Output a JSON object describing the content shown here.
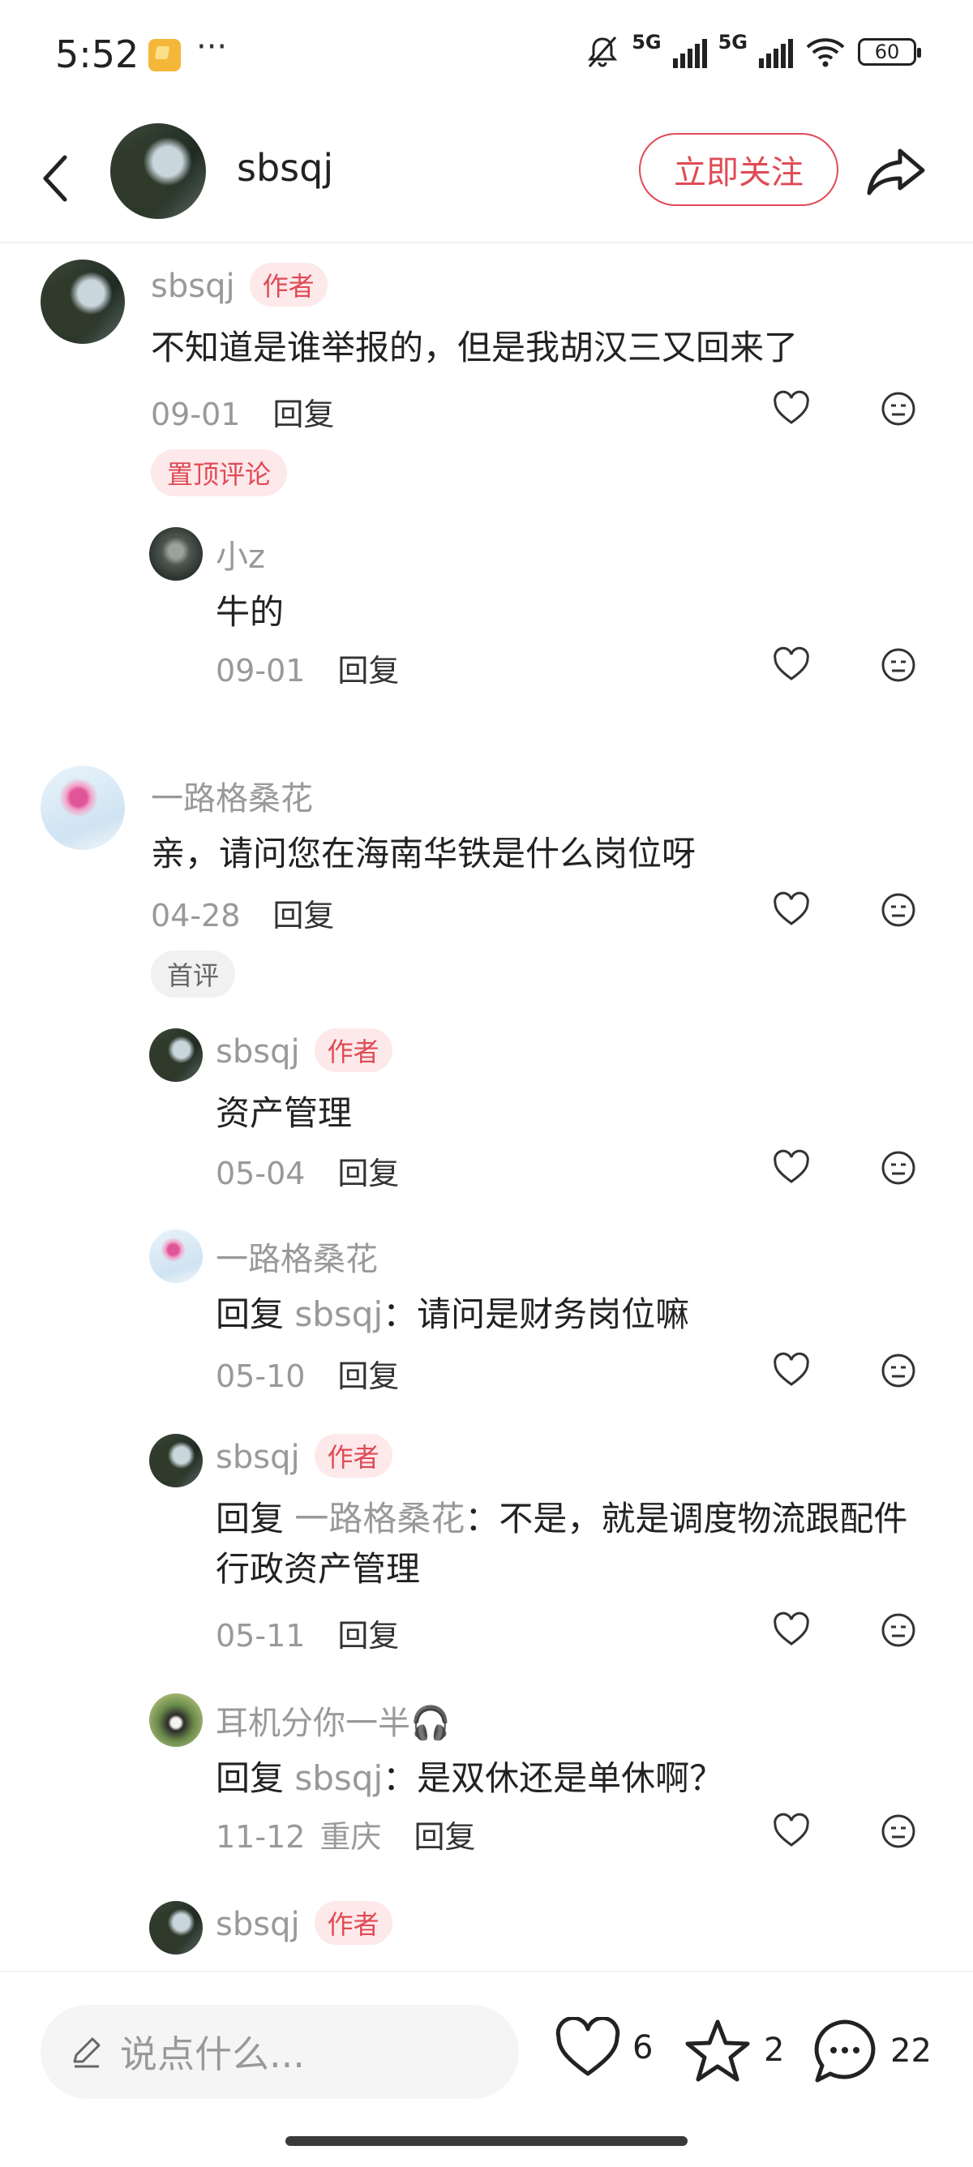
{
  "status_bar": {
    "time": "5:52",
    "more": "···",
    "network_1": "5G",
    "network_2": "5G",
    "battery": "60"
  },
  "header": {
    "username": "sbsqj",
    "follow_label": "立即关注"
  },
  "comments": [
    {
      "user": "sbsqj",
      "tag": "作者",
      "text": "不知道是谁举报的，但是我胡汉三又回来了",
      "date": "09-01",
      "reply": "回复",
      "badge": "置顶评论"
    },
    {
      "user": "小z",
      "text": "牛的",
      "date": "09-01",
      "reply": "回复"
    },
    {
      "user": "一路格桑花",
      "text": "亲，请问您在海南华铁是什么岗位呀",
      "date": "04-28",
      "reply": "回复",
      "badge": "首评"
    },
    {
      "user": "sbsqj",
      "tag": "作者",
      "text": "资产管理",
      "date": "05-04",
      "reply": "回复"
    },
    {
      "user": "一路格桑花",
      "reply_prefix": "回复",
      "reply_to": "sbsqj",
      "text": "：请问是财务岗位嘛",
      "date": "05-10",
      "reply": "回复"
    },
    {
      "user": "sbsqj",
      "tag": "作者",
      "reply_prefix": "回复",
      "reply_to": "一路格桑花",
      "text": "：不是，就是调度物流跟配件行政资产管理",
      "date": "05-11",
      "reply": "回复"
    },
    {
      "user": "耳机分你一半🎧",
      "reply_prefix": "回复",
      "reply_to": "sbsqj",
      "text": "：是双休还是单休啊？",
      "date": "11-12",
      "location": "重庆",
      "reply": "回复"
    },
    {
      "user": "sbsqj",
      "tag": "作者"
    }
  ],
  "bottom_bar": {
    "input_placeholder": "说点什么...",
    "likes": "6",
    "favorites": "2",
    "comments": "22"
  },
  "colors": {
    "accent": "#e04a55",
    "muted": "#999999",
    "text": "#222222"
  }
}
